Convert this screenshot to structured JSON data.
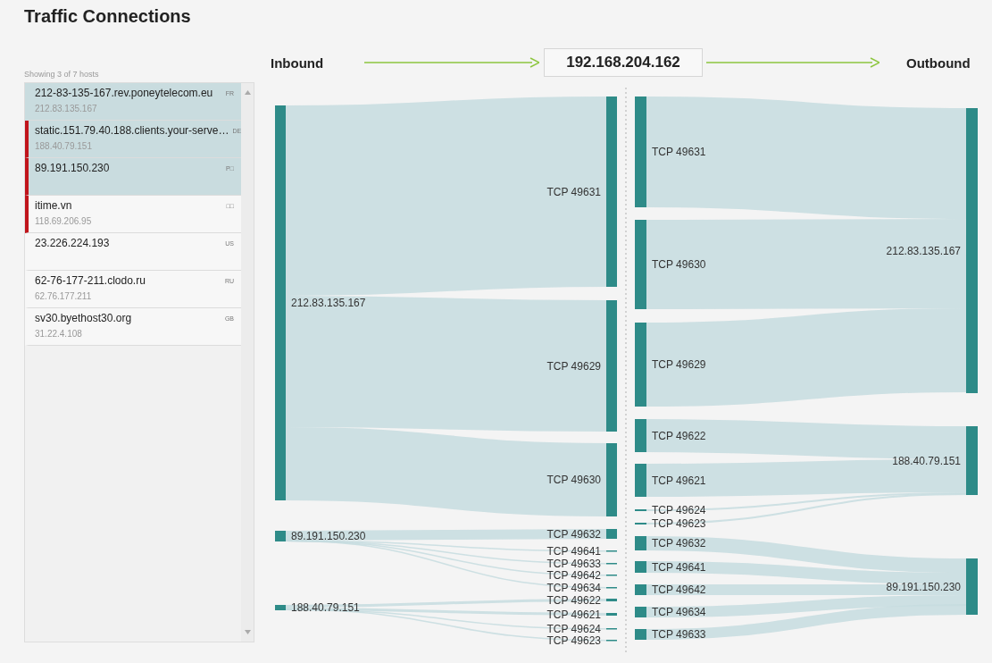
{
  "title": "Traffic Connections",
  "hosts_panel": {
    "summary": "Showing 3 of 7 hosts",
    "hosts": [
      {
        "name": "212-83-135-167.rev.poneytelecom.eu",
        "ip": "212.83.135.167",
        "country": "FR",
        "selected": true,
        "flagged": false
      },
      {
        "name": "static.151.79.40.188.clients.your-serve…",
        "ip": "188.40.79.151",
        "country": "DE",
        "selected": true,
        "flagged": true
      },
      {
        "name": "89.191.150.230",
        "country": "P□",
        "selected": true,
        "flagged": true
      },
      {
        "name": "itime.vn",
        "ip": "118.69.206.95",
        "country": "□□",
        "selected": false,
        "flagged": true
      },
      {
        "name": "23.226.224.193",
        "country": "US",
        "selected": false,
        "flagged": false
      },
      {
        "name": "62-76-177-211.clodo.ru",
        "ip": "62.76.177.211",
        "country": "RU",
        "selected": false,
        "flagged": false
      },
      {
        "name": "sv30.byethost30.org",
        "ip": "31.22.4.108",
        "country": "GB",
        "selected": false,
        "flagged": false
      }
    ]
  },
  "flow_header": {
    "inbound": "Inbound",
    "host": "192.168.204.162",
    "outbound": "Outbound"
  },
  "diagram": {
    "inbound": [
      {
        "host": "212.83.135.167",
        "ports": [
          "TCP 49631",
          "TCP 49629",
          "TCP 49630"
        ]
      },
      {
        "host": "89.191.150.230",
        "ports": [
          "TCP 49632",
          "TCP 49641",
          "TCP 49633",
          "TCP 49642",
          "TCP 49634"
        ]
      },
      {
        "host": "188.40.79.151",
        "ports": [
          "TCP 49622",
          "TCP 49621",
          "TCP 49624",
          "TCP 49623"
        ]
      }
    ],
    "outbound": [
      {
        "host": "212.83.135.167",
        "ports": [
          "TCP 49631",
          "TCP 49630",
          "TCP 49629"
        ]
      },
      {
        "host": "188.40.79.151",
        "ports": [
          "TCP 49622",
          "TCP 49621",
          "TCP 49624",
          "TCP 49623"
        ]
      },
      {
        "host": "89.191.150.230",
        "ports": [
          "TCP 49632",
          "TCP 49641",
          "TCP 49642",
          "TCP 49634",
          "TCP 49633"
        ]
      }
    ]
  }
}
